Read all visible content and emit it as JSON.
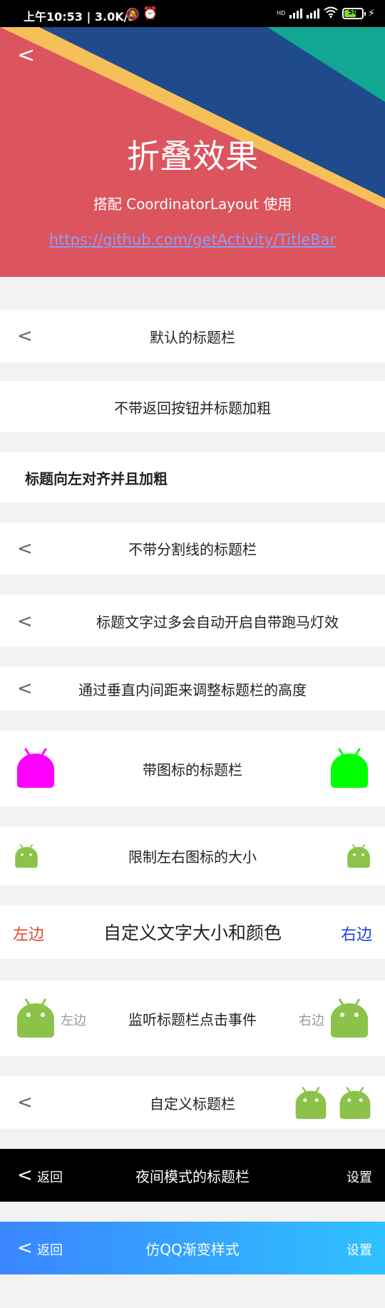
{
  "status_bar": {
    "time": "上午10:53 | 3.0K/s",
    "battery": "50",
    "signal_label": "HD"
  },
  "header": {
    "title": "折叠效果",
    "subtitle": "搭配 CoordinatorLayout 使用",
    "link": "https://github.com/getActivity/TitleBar"
  },
  "rows": [
    {
      "title": "默认的标题栏"
    },
    {
      "title": "不带返回按钮并标题加粗"
    },
    {
      "title": "标题向左对齐并且加粗"
    },
    {
      "title": "不带分割线的标题栏"
    },
    {
      "title": "标题文字过多会自动开启自带跑马灯效"
    },
    {
      "title": "通过垂直内间距来调整标题栏的高度"
    },
    {
      "title": "带图标的标题栏"
    },
    {
      "title": "限制左右图标的大小"
    },
    {
      "title": "自定义文字大小和颜色",
      "left": "左边",
      "right": "右边"
    },
    {
      "title": "监听标题栏点击事件",
      "left": "左边",
      "right": "右边"
    },
    {
      "title": "自定义标题栏"
    },
    {
      "title": "夜间模式的标题栏",
      "left": "返回",
      "right": "设置"
    },
    {
      "title": "仿QQ渐变样式",
      "left": "返回",
      "right": "设置"
    }
  ],
  "colors": {
    "header_red": "#dc545e",
    "header_blue": "#1f4a8c",
    "header_teal": "#13a894",
    "header_yellow": "#f5c05a",
    "magenta_icon": "#ff00ff",
    "green_icon": "#00ff00",
    "android_green": "#8bc34a",
    "custom_left_color": "#e1472e",
    "custom_right_color": "#2340d8",
    "night_bg": "#000000",
    "qq_gradient_start": "#3a86ff",
    "qq_gradient_end": "#2fc1ff"
  },
  "icons": [
    "back-chevron-icon",
    "android-icon",
    "bell-off-icon",
    "alarm-icon",
    "wifi-icon",
    "charging-icon"
  ]
}
